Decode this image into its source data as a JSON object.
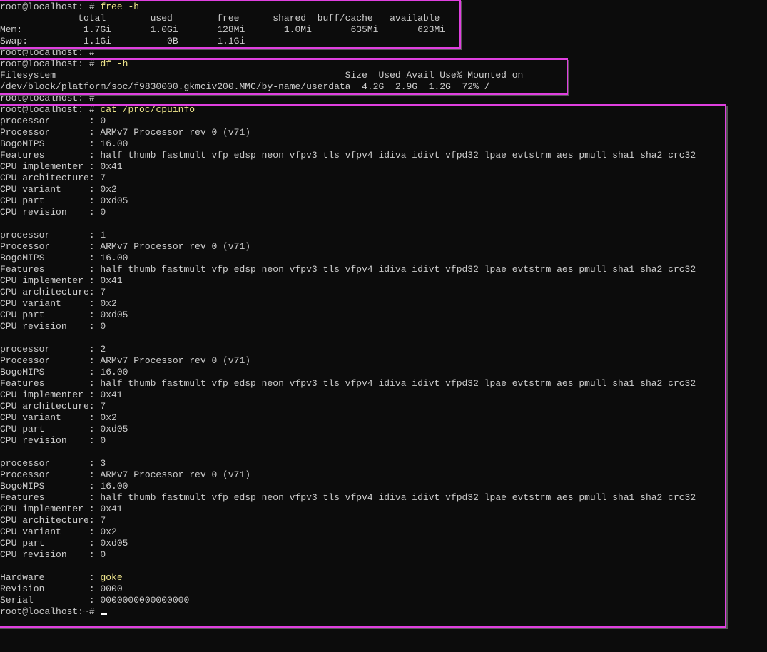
{
  "terminal": {
    "prompt": "root@localhost: # ",
    "final_prompt": "root@localhost:~# ",
    "free_cmd": "free -h",
    "free_header": "              total        used        free      shared  buff/cache   available",
    "free_mem": "Mem:           1.7Gi       1.0Gi       128Mi       1.0Mi       635Mi       623Mi",
    "free_swap": "Swap:          1.1Gi          0B       1.1Gi",
    "df_cmd": "df -h",
    "df_header": "Filesystem                                                    Size  Used Avail Use% Mounted on",
    "df_row": "/dev/block/platform/soc/f9830000.gkmciv200.MMC/by-name/userdata  4.2G  2.9G  1.2G  72% /",
    "cpu_cmd": "cat /proc/cpuinfo",
    "cpu": [
      {
        "processor": "processor       : 0",
        "model": "Processor       : ARMv7 Processor rev 0 (v71)",
        "bogomips": "BogoMIPS        : 16.00",
        "features": "Features        : half thumb fastmult vfp edsp neon vfpv3 tls vfpv4 idiva idivt vfpd32 lpae evtstrm aes pmull sha1 sha2 crc32",
        "implementer": "CPU implementer : 0x41",
        "architecture": "CPU architecture: 7",
        "variant": "CPU variant     : 0x2",
        "part": "CPU part        : 0xd05",
        "revision": "CPU revision    : 0"
      },
      {
        "processor": "processor       : 1",
        "model": "Processor       : ARMv7 Processor rev 0 (v71)",
        "bogomips": "BogoMIPS        : 16.00",
        "features": "Features        : half thumb fastmult vfp edsp neon vfpv3 tls vfpv4 idiva idivt vfpd32 lpae evtstrm aes pmull sha1 sha2 crc32",
        "implementer": "CPU implementer : 0x41",
        "architecture": "CPU architecture: 7",
        "variant": "CPU variant     : 0x2",
        "part": "CPU part        : 0xd05",
        "revision": "CPU revision    : 0"
      },
      {
        "processor": "processor       : 2",
        "model": "Processor       : ARMv7 Processor rev 0 (v71)",
        "bogomips": "BogoMIPS        : 16.00",
        "features": "Features        : half thumb fastmult vfp edsp neon vfpv3 tls vfpv4 idiva idivt vfpd32 lpae evtstrm aes pmull sha1 sha2 crc32",
        "implementer": "CPU implementer : 0x41",
        "architecture": "CPU architecture: 7",
        "variant": "CPU variant     : 0x2",
        "part": "CPU part        : 0xd05",
        "revision": "CPU revision    : 0"
      },
      {
        "processor": "processor       : 3",
        "model": "Processor       : ARMv7 Processor rev 0 (v71)",
        "bogomips": "BogoMIPS        : 16.00",
        "features": "Features        : half thumb fastmult vfp edsp neon vfpv3 tls vfpv4 idiva idivt vfpd32 lpae evtstrm aes pmull sha1 sha2 crc32",
        "implementer": "CPU implementer : 0x41",
        "architecture": "CPU architecture: 7",
        "variant": "CPU variant     : 0x2",
        "part": "CPU part        : 0xd05",
        "revision": "CPU revision    : 0"
      }
    ],
    "hardware_label": "Hardware        : ",
    "hardware_value": "goke",
    "revision_line": "Revision        : 0000",
    "serial_line": "Serial          : 0000000000000000"
  },
  "colors": {
    "background": "#0c0c0c",
    "text": "#cccccc",
    "command": "#f0e68c",
    "highlight_box": "#e040e0"
  }
}
